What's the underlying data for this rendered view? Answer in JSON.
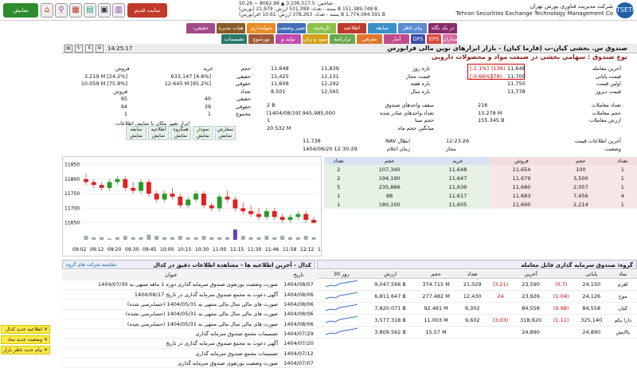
{
  "header": {
    "company_fa": "شرکت مدیریت فناوری بورس تهران",
    "company_en": "Tehran Securities Exchange Technology Management Co",
    "logo": "TSETMC",
    "ticker": [
      "شاخص: 3,106,517.5 ▲ 8062.99 ~ 50.26-",
      "(بورس) بسته - تعداد: 531,399 ارزش: 21,979 B 151,389.748 B",
      "(فرابورس) بسته - تعداد: 378,263 ارزش: 10.61 B 1,774,094.591 B"
    ],
    "show_list": "نمایش فهرست",
    "site_old": "سایت قدیم",
    "icons": [
      "home-icon",
      "search-icon",
      "grid-icon",
      "chart-icon",
      "table-icon",
      "book-icon"
    ]
  },
  "menu": {
    "row1": [
      {
        "label": "در یک نگاه",
        "color": "#8a2a6c"
      },
      {
        "label": "پیام ناظر",
        "color": "#5a8ad0"
      },
      {
        "label": "سابقه",
        "color": "#3a8fc9"
      },
      {
        "label": "اطلاعیه",
        "color": "#c0392b"
      },
      {
        "label": "تاریخچه",
        "color": "#8bc34a"
      },
      {
        "label": "تغییر وضعیت",
        "color": "#3f6fb8"
      },
      {
        "label": "سهامداری",
        "color": "#e98b24"
      },
      {
        "label": "هیات مدیره",
        "color": "#8a5a2a"
      },
      {
        "label": "حقیقی-حقوقی",
        "color": "#a24a8a"
      }
    ],
    "row2": [
      {
        "label": "سهامداران",
        "color": "#d96aa0"
      },
      {
        "label": "EPS",
        "color": "#d94a3a"
      },
      {
        "label": "DPS",
        "color": "#3a4fa8"
      },
      {
        "label": "آمار",
        "color": "#c04a8a"
      },
      {
        "label": "معرفی",
        "color": "#e0762a"
      },
      {
        "label": "ترازنامه",
        "color": "#6aa84f"
      },
      {
        "label": "سود و زیان",
        "color": "#d4a017"
      },
      {
        "label": "تولید و فروش",
        "color": "#c04ab0"
      },
      {
        "label": "بورسوچ",
        "color": "#a25a3a"
      },
      {
        "label": "تصمیمات مجمع",
        "color": "#2a7a6a"
      }
    ]
  },
  "toolbar": {
    "time": "14:25:17"
  },
  "instrument": {
    "title": "صندوق س. بخشی کیان-ب (فارما کیان) - بازار ابزارهای نوین مالی فرابورس",
    "subtitle": "نوع صندوق : سهامی بخشی در صنعت مواد و محصولات دارویی"
  },
  "prices": {
    "rows": [
      {
        "label": "آخرین معامله",
        "value": "11,648",
        "chg": "(136)",
        "pct": "[-1.1%]"
      },
      {
        "label": "قیمت پایانی",
        "value": "11,700",
        "chg": "(78)",
        "pct": "[-0.66%]"
      },
      {
        "label": "اولین قیمت",
        "value": "11,750",
        "chg": "",
        "pct": ""
      },
      {
        "label": "قیمت دیروز",
        "value": "11,778",
        "chg": "",
        "pct": ""
      }
    ],
    "ranges": [
      {
        "label": "بازه روز",
        "lo": "11,648",
        "hi": "11,839"
      },
      {
        "label": "قیمت مجاز",
        "lo": "11,425",
        "hi": "12,131"
      },
      {
        "label": "بازه هفته",
        "lo": "11,608",
        "hi": "12,292"
      },
      {
        "label": "بازه سال",
        "lo": "8,501",
        "hi": "12,565"
      }
    ]
  },
  "stats": [
    {
      "label": "تعداد معاملات",
      "value": "216"
    },
    {
      "label": "حجم معاملات",
      "value": "13.278 M"
    },
    {
      "label": "ارزش معاملات",
      "value": "155.345 B"
    }
  ],
  "fund": [
    {
      "label": "سقف واحدهای صندوق",
      "value": "2 B"
    },
    {
      "label": "تعداد واحدهای صادر شده",
      "value": "[1404/08/19] 945,985,000"
    },
    {
      "label": "حجم مبنا",
      "value": "1"
    },
    {
      "label": "میانگین حجم ماه",
      "value": "20.532 M"
    }
  ],
  "nav": [
    {
      "label": "آخرین اطلاعات قیمت",
      "value": "12:23:26"
    },
    {
      "label": "وضعیت",
      "value": "مجاز"
    },
    {
      "label": "NAV ابطال",
      "value": "11,738"
    },
    {
      "label": "زمان اعلام",
      "value": "1404/08/20  12:30:29"
    }
  ],
  "trader": {
    "headers": {
      "type": "",
      "buy": "خرید",
      "sell": "فروش"
    },
    "rows": [
      {
        "label": "حجم",
        "buy": "",
        "sell": ""
      },
      {
        "label": "حقیقی",
        "buy": "633,147 [4.8%]",
        "sell": "3.219 M [24.2%]"
      },
      {
        "label": "حقوقی",
        "buy": "12.645 M [95.2%]",
        "sell": "10.059 M [75.8%]"
      },
      {
        "label": "تعداد",
        "buy": "",
        "sell": "فروش"
      },
      {
        "label": "حقیقی",
        "buy": "40",
        "sell": "95"
      },
      {
        "label": "حقوقی",
        "buy": "39",
        "sell": "94"
      },
      {
        "label": "مجموع",
        "buy": "1",
        "sell": "1"
      }
    ],
    "note": "ابزار تغییر مکان با نمایش اطلاعات",
    "buttons": [
      "سفارش نمایش",
      "نمودار نمایش",
      "همگروه نمایش",
      "اطلاعیه نمایش",
      "سابقه نمایش"
    ]
  },
  "orderbook": {
    "headers": [
      "تعداد",
      "حجم",
      "خرید",
      "فروش",
      "حجم",
      "تعداد"
    ],
    "rows": [
      [
        "2",
        "107,340",
        "11,648",
        "11,654",
        "100",
        "1"
      ],
      [
        "2",
        "194,190",
        "11,647",
        "11,679",
        "3,500",
        "1"
      ],
      [
        "5",
        "235,886",
        "11,639",
        "11,680",
        "2,057",
        "1"
      ],
      [
        "1",
        "88",
        "11,617",
        "11,683",
        "7,456",
        "4"
      ],
      [
        "1",
        "180,100",
        "11,605",
        "11,690",
        "2,214",
        "1"
      ]
    ]
  },
  "chart_data": {
    "type": "candlestick",
    "x_ticks": [
      "09:02",
      "09:12",
      "09:20",
      "09:30",
      "09:45",
      "10:00",
      "10:15",
      "10:30",
      "11:00",
      "11:15",
      "11:30",
      "11:46",
      "11:58",
      "12:12",
      "12:22"
    ],
    "y_ticks": [
      11650,
      11700,
      11750,
      11800,
      11850
    ],
    "ylim": [
      11630,
      11860
    ],
    "candles": [
      [
        11800,
        11820,
        11780,
        11790
      ],
      [
        11790,
        11800,
        11770,
        11780
      ],
      [
        11780,
        11790,
        11760,
        11770
      ],
      [
        11770,
        11800,
        11760,
        11790
      ],
      [
        11790,
        11810,
        11780,
        11800
      ],
      [
        11800,
        11810,
        11760,
        11770
      ],
      [
        11770,
        11790,
        11750,
        11760
      ],
      [
        11760,
        11800,
        11750,
        11790
      ],
      [
        11790,
        11800,
        11740,
        11750
      ],
      [
        11750,
        11760,
        11720,
        11730
      ],
      [
        11730,
        11760,
        11720,
        11750
      ],
      [
        11750,
        11770,
        11730,
        11740
      ],
      [
        11740,
        11750,
        11700,
        11710
      ],
      [
        11710,
        11740,
        11700,
        11730
      ],
      [
        11730,
        11760,
        11720,
        11750
      ],
      [
        11750,
        11760,
        11700,
        11710
      ],
      [
        11710,
        11720,
        11690,
        11700
      ],
      [
        11700,
        11750,
        11690,
        11740
      ],
      [
        11740,
        11760,
        11720,
        11730
      ],
      [
        11730,
        11740,
        11690,
        11700
      ],
      [
        11700,
        11720,
        11680,
        11690
      ],
      [
        11690,
        11710,
        11670,
        11680
      ],
      [
        11680,
        11700,
        11660,
        11670
      ],
      [
        11670,
        11700,
        11660,
        11690
      ],
      [
        11690,
        11700,
        11660,
        11670
      ],
      [
        11670,
        11680,
        11650,
        11660
      ],
      [
        11660,
        11680,
        11650,
        11670
      ],
      [
        11670,
        11690,
        11660,
        11680
      ],
      [
        11680,
        11690,
        11650,
        11660
      ],
      [
        11660,
        11670,
        11648,
        11650
      ]
    ],
    "volumes": [
      3,
      2,
      2,
      1,
      2,
      3,
      2,
      2,
      4,
      3,
      2,
      2,
      3,
      2,
      2,
      3,
      2,
      2,
      2,
      8,
      3,
      2,
      2,
      3,
      2,
      3,
      2,
      2,
      3,
      2
    ]
  },
  "news": {
    "header": "کدال - آخرین اطلاعیه ها - مشاهده اطلاعات دقیق در کدال",
    "compare": "مقایسه شرکت های گروه",
    "col_date": "تاریخ",
    "col_title": "عنوان",
    "items": [
      {
        "date": "1404/08/07",
        "title": "صورت وضعیت پورتفوی صندوق سرمایه گذاری دوره 1 ماهه منتهی به 1404/07/30"
      },
      {
        "date": "1404/08/06",
        "title": "آگهی دعوت به مجمع صندوق سرمایه گذاری در تاریخ 1404/08/17"
      },
      {
        "date": "1404/08/06",
        "title": "صورت های مالی سال مالی منتهی به 1404/05/31 (حسابرسی شده)"
      },
      {
        "date": "1404/08/06",
        "title": "صورت های مالی سال مالی منتهی به 1404/05/31 (حسابرسی نشده)"
      },
      {
        "date": "1404/08/06",
        "title": "صورت های مالی سال مالی منتهی به 1404/05/31 (حسابرسی شده)"
      },
      {
        "date": "1404/07/29",
        "title": "تصمیمات مجمع صندوق سرمایه گذاری"
      },
      {
        "date": "1404/07/20",
        "title": "آگهی دعوت به مجمع صندوق سرمایه گذاری در تاریخ"
      },
      {
        "date": "1404/07/12",
        "title": "تصمیمات مجمع صندوق سرمایه گذاری"
      },
      {
        "date": "1404/07/07",
        "title": "صورت وضعیت پورتفوی صندوق سرمایه گذاری"
      }
    ]
  },
  "group": {
    "header": "گروه: صندوق سرمایه گذاری قابل معامله",
    "columns": [
      "نماد",
      "پایانی",
      "",
      "آخرین",
      "",
      "تعداد",
      "حجم",
      "ارزش",
      "30 روز"
    ],
    "rows": [
      {
        "sym": "اهرم",
        "close": "24,150",
        "cchg": "(0.7)",
        "last": "23,590",
        "lchg": "(3.21)",
        "cnt": "21,029",
        "vol": "374.715 M",
        "val": "9,047.566 B"
      },
      {
        "sym": "موج",
        "close": "24,126",
        "cchg": "(1.04)",
        "last": "23,926",
        "lchg": "24",
        "cnt": "12,430",
        "vol": "277.482 M",
        "val": "6,811.647 B"
      },
      {
        "sym": "کیان",
        "close": "84,558",
        "cchg": "(0.98)",
        "last": "84,558",
        "lchg": "",
        "cnt": "6,302",
        "vol": "92.481 M",
        "val": "7,820.071 B"
      },
      {
        "sym": "دارا یکم",
        "close": "325,140",
        "cchg": "(1.11)",
        "last": "318,920",
        "lchg": "(3.03)",
        "cnt": "9,602",
        "vol": "11.003 M",
        "val": "3,577.318 B"
      },
      {
        "sym": "پالایش",
        "close": "24,890",
        "cchg": "",
        "last": "24,890",
        "lchg": "",
        "cnt": "",
        "vol": "15.57 M",
        "val": "3,809.562 B"
      }
    ]
  },
  "side_alerts": [
    "اطلاعیه جدید کدال",
    "وضعیت جدید نماد",
    "پیام جدید ناظر بازار"
  ]
}
